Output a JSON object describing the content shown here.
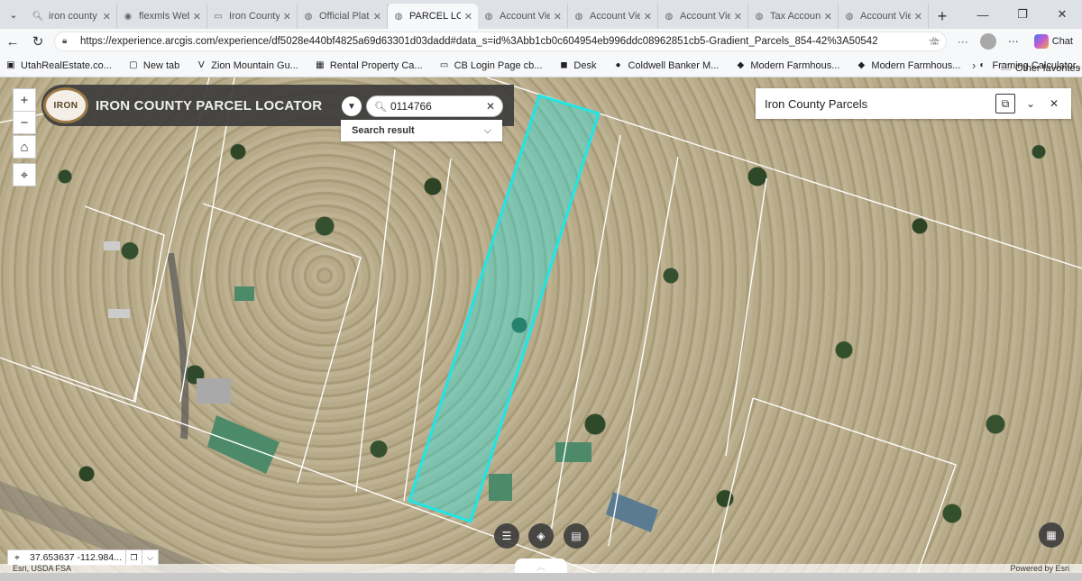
{
  "browser": {
    "tabs": [
      {
        "title": "iron county m",
        "icon": "search-icon"
      },
      {
        "title": "flexmls Web",
        "icon": "flexmls-icon"
      },
      {
        "title": "Iron County",
        "icon": "page-icon"
      },
      {
        "title": "Official Plat M",
        "icon": "globe-icon"
      },
      {
        "title": "PARCEL LOCAT",
        "icon": "globe-icon",
        "active": true
      },
      {
        "title": "Account View",
        "icon": "globe-icon"
      },
      {
        "title": "Account View",
        "icon": "globe-icon"
      },
      {
        "title": "Account View",
        "icon": "globe-icon"
      },
      {
        "title": "Tax Account",
        "icon": "globe-icon"
      },
      {
        "title": "Account View",
        "icon": "globe-icon"
      }
    ],
    "url": "https://experience.arcgis.com/experience/df5028e440bf4825a69d63301d03dadd#data_s=id%3Abb1cb0c604954eb996ddc08962851cb5-Gradient_Parcels_854-42%3A50542",
    "chat_label": "Chat",
    "favorites": [
      {
        "label": "UtahRealEstate.co...",
        "icon": "ure-icon"
      },
      {
        "label": "New tab",
        "icon": "newtab-icon"
      },
      {
        "label": "Zion Mountain Gu...",
        "icon": "zion-icon"
      },
      {
        "label": "Rental Property Ca...",
        "icon": "calc-icon"
      },
      {
        "label": "CB Login Page cb...",
        "icon": "page-icon"
      },
      {
        "label": "Desk",
        "icon": "desk-icon"
      },
      {
        "label": "Coldwell Banker M...",
        "icon": "cb-icon"
      },
      {
        "label": "Modern Farmhous...",
        "icon": "farmhouse-icon"
      },
      {
        "label": "Modern Farmhous...",
        "icon": "farmhouse-icon"
      },
      {
        "label": "Framing Calculator...",
        "icon": "framing-icon"
      }
    ],
    "other_favorites": "Other favorites"
  },
  "app": {
    "logo_text": "IRON",
    "title": "IRON COUNTY PARCEL LOCATOR",
    "search_value": "0114766",
    "search_result_label": "Search result",
    "panel_title": "Iron County Parcels",
    "coordinates": "37.653637 -112.984...",
    "attribution": "Esri, USDA FSA",
    "powered_by": "Powered by Esri"
  },
  "colors": {
    "highlight_parcel": "#1fe6e6",
    "parcel_lines": "#ffffff",
    "header_bg": "#3c3c3c"
  }
}
